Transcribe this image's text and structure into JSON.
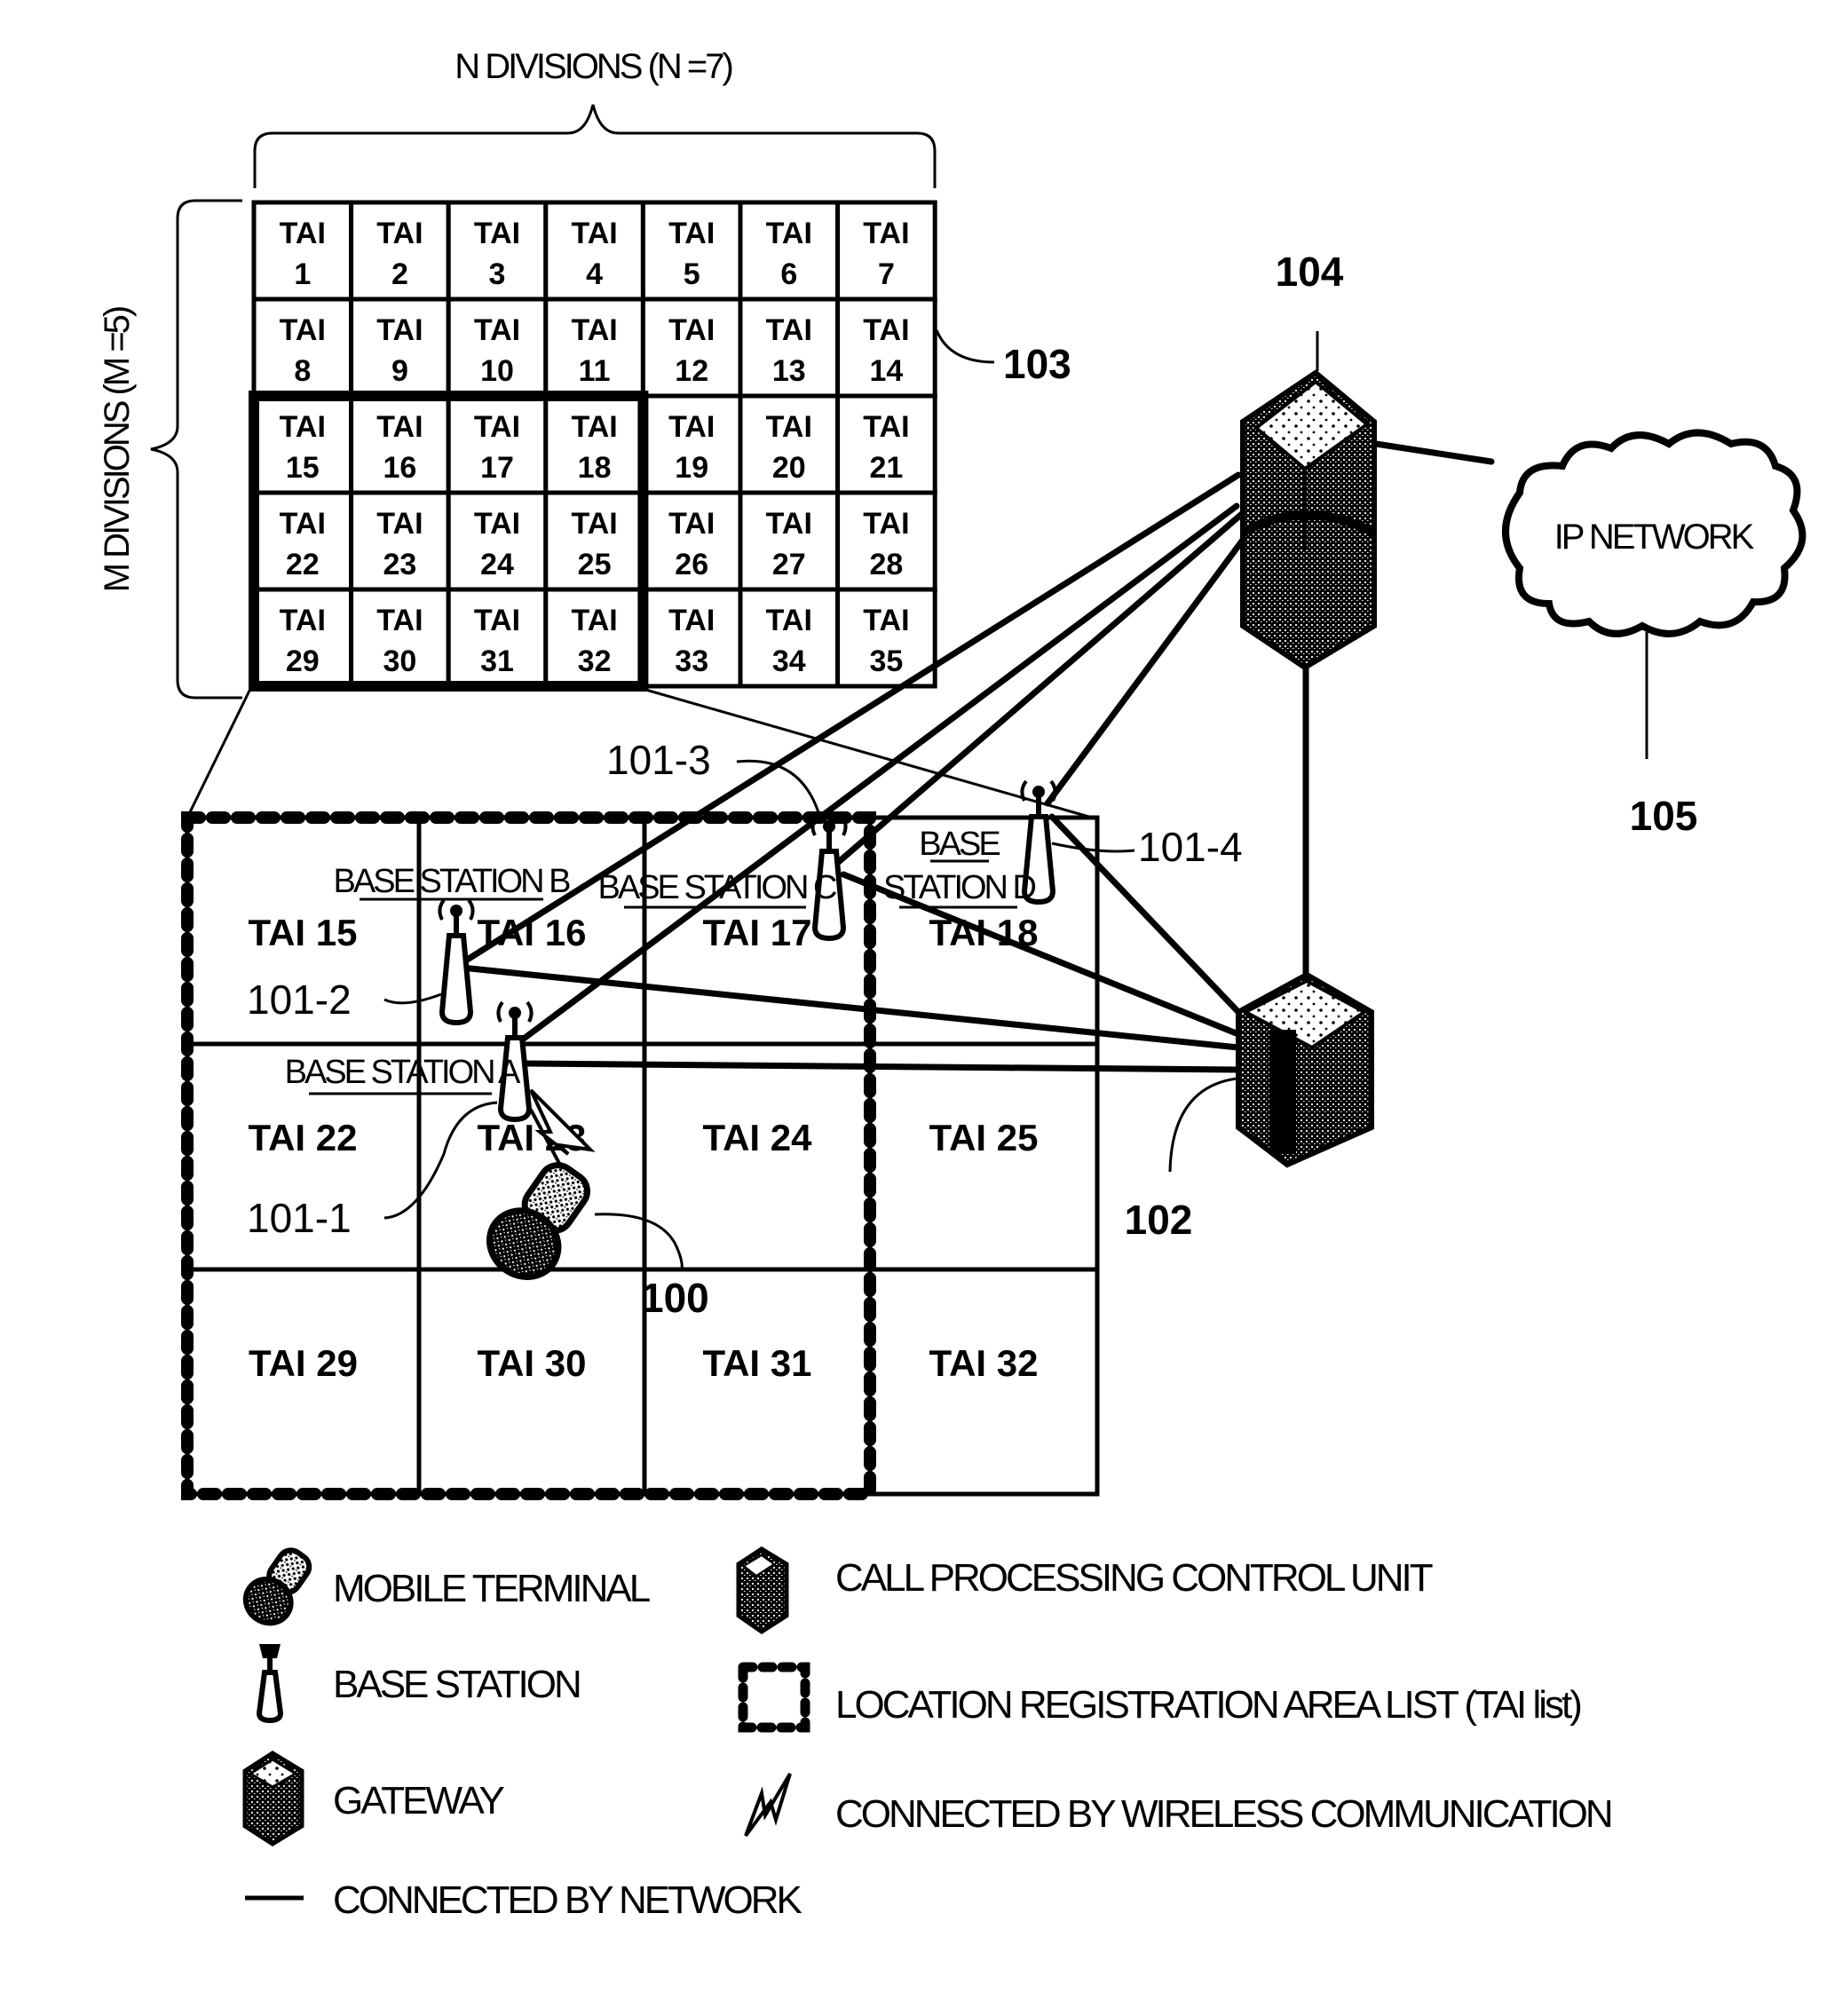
{
  "top_grid": {
    "label_n": "N DIVISIONS (N =7)",
    "label_m": "M DIVISIONS (M =5)",
    "columns": 7,
    "rows": 5,
    "cell_prefix": "TAI",
    "cells": [
      "1",
      "2",
      "3",
      "4",
      "5",
      "6",
      "7",
      "8",
      "9",
      "10",
      "11",
      "12",
      "13",
      "14",
      "15",
      "16",
      "17",
      "18",
      "19",
      "20",
      "21",
      "22",
      "23",
      "24",
      "25",
      "26",
      "27",
      "28",
      "29",
      "30",
      "31",
      "32",
      "33",
      "34",
      "35"
    ],
    "highlighted_cells": [
      "15",
      "16",
      "17",
      "18",
      "22",
      "23",
      "24",
      "25",
      "29",
      "30",
      "31",
      "32"
    ],
    "ref": "103"
  },
  "lower_grid": {
    "cells": [
      [
        "TAI 15",
        "TAI 16",
        "TAI 17",
        "TAI 18"
      ],
      [
        "TAI 22",
        "TAI 23",
        "TAI 24",
        "TAI 25"
      ],
      [
        "TAI 29",
        "TAI 30",
        "TAI 31",
        "TAI 32"
      ]
    ],
    "tai_list_columns": 3
  },
  "base_stations": [
    {
      "name": "BASE STATION A",
      "ref": "101-1"
    },
    {
      "name": "BASE STATION B",
      "ref": "101-2"
    },
    {
      "name": "BASE STATION C",
      "ref": "101-3"
    },
    {
      "name_line1": "BASE",
      "name_line2": "STATION D",
      "ref": "101-4"
    }
  ],
  "mobile_terminal": {
    "ref": "100"
  },
  "call_processing_unit": {
    "ref": "102"
  },
  "gateway": {
    "ref": "104"
  },
  "ip_network": {
    "label": "IP NETWORK",
    "ref": "105"
  },
  "legend": {
    "left": [
      {
        "icon": "mobile-terminal-icon",
        "label": "MOBILE TERMINAL"
      },
      {
        "icon": "base-station-icon",
        "label": "BASE STATION"
      },
      {
        "icon": "gateway-icon",
        "label": "GATEWAY"
      },
      {
        "icon": "network-line-icon",
        "label": "CONNECTED BY NETWORK"
      }
    ],
    "right": [
      {
        "icon": "call-processing-unit-icon",
        "label": "CALL PROCESSING CONTROL UNIT"
      },
      {
        "icon": "dashed-box-icon",
        "label": "LOCATION REGISTRATION AREA LIST (TAI list)"
      },
      {
        "icon": "lightning-icon",
        "label": "CONNECTED BY WIRELESS COMMUNICATION"
      }
    ]
  }
}
